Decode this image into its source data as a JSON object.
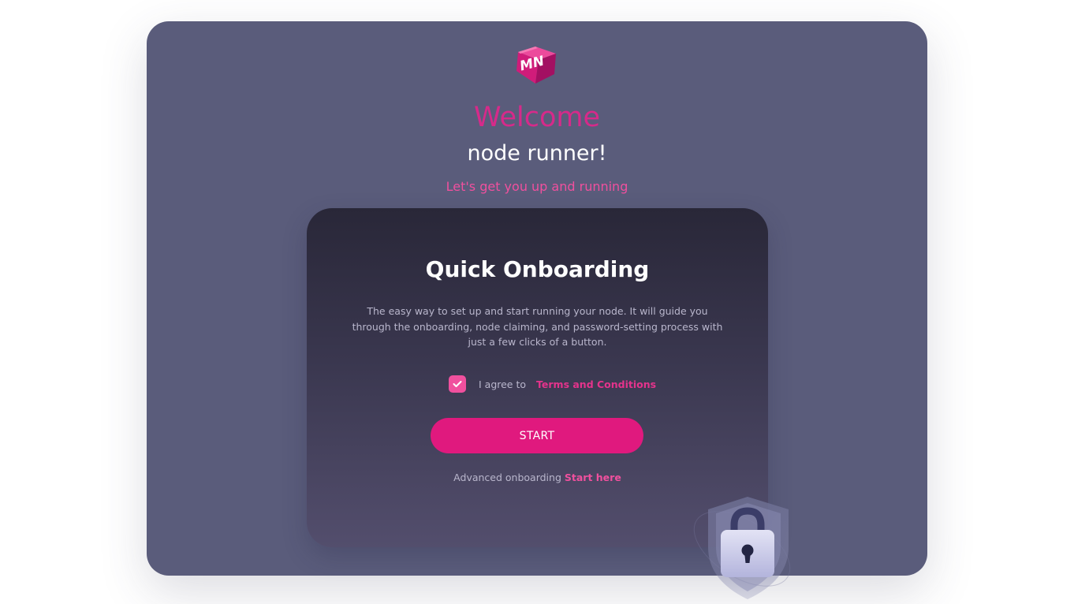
{
  "header": {
    "logo_letters": "MN",
    "welcome": "Welcome",
    "subtitle": "node runner!",
    "tagline": "Let's get you up and running"
  },
  "card": {
    "title": "Quick Onboarding",
    "description": "The easy way to set up and start running your node. It will guide you through the onboarding, node claiming, and password-setting process with just a few clicks of a button.",
    "agree_checked": true,
    "agree_label": "I agree to",
    "terms_link": "Terms and Conditions",
    "start_button": "START",
    "advanced_label": "Advanced onboarding",
    "advanced_link": "Start here"
  },
  "icons": {
    "logo": "mn-cube-logo-icon",
    "checkbox": "check-icon",
    "illustration": "shield-lock-icon"
  },
  "colors": {
    "panel_background": "#5a5c7b",
    "accent_pink": "#e0197e",
    "welcome_pink": "#d62a8a",
    "link_pink": "#f0509e",
    "card_top": "#292738",
    "card_bottom": "#534e6d"
  }
}
